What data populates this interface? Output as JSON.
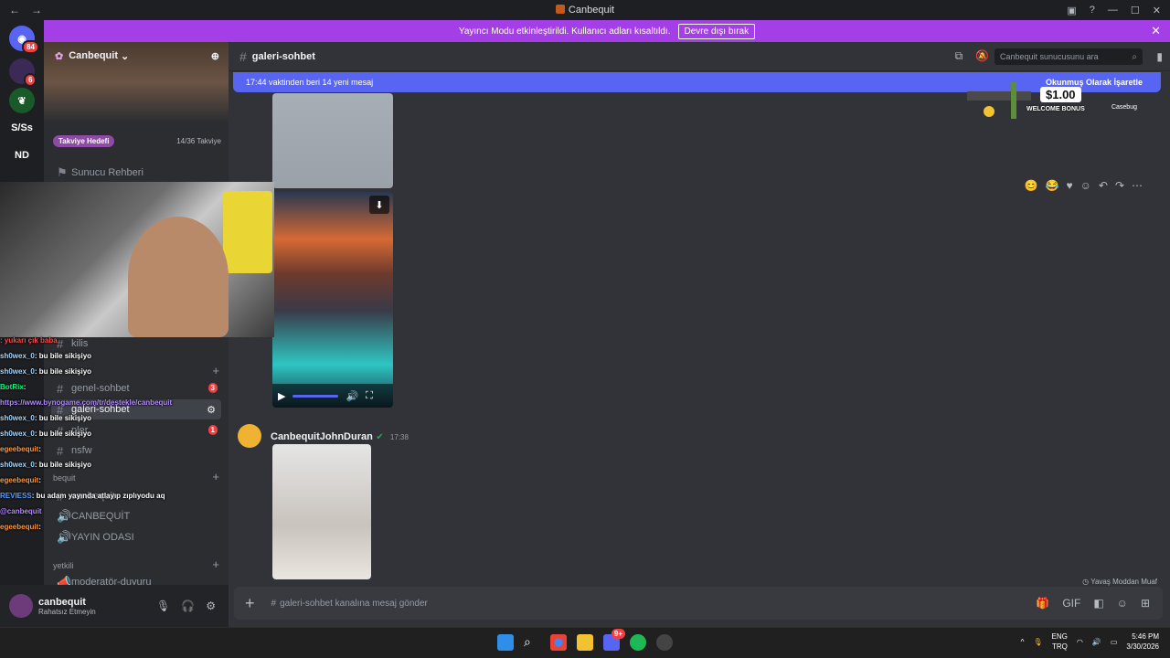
{
  "window": {
    "title": "Canbequit",
    "nav_back": "←",
    "nav_fwd": "→"
  },
  "banner": {
    "text": "Yayıncı Modu etkinleştirildi. Kullanıcı adları kısaltıldı.",
    "button": "Devre dışı bırak",
    "close": "✕"
  },
  "rail": {
    "dm_badge": "84",
    "second_badge": "6",
    "items": [
      "S/Ss",
      "ND"
    ]
  },
  "server": {
    "name": "Canbequit",
    "boost_label": "Takviye Hedefi",
    "boost_count": "14/36 Takviye",
    "guide": "Sunucu Rehberi",
    "channels": [
      {
        "name": "kilis"
      },
      {
        "name": "genel-sohbet",
        "badge": "3"
      },
      {
        "name": "galeri-sohbet"
      },
      {
        "name": "pler",
        "badge": "1"
      },
      {
        "name": "nsfw"
      },
      {
        "name": "canbequit"
      },
      {
        "name": "CANBEQUİT"
      },
      {
        "name": "YAYIN ODASI"
      },
      {
        "name": "moderatör-duyuru"
      }
    ],
    "categories": {
      "bequit": "bequit",
      "yetkili": "yetkili"
    }
  },
  "user": {
    "name": "canbequit",
    "status": "Rahatsız Etmeyin"
  },
  "channel": {
    "name": "galeri-sohbet",
    "search_placeholder": "Canbequit sunucusunu ara"
  },
  "new_messages": {
    "text": "17:44 vaktinden beri 14 yeni mesaj",
    "mark_read": "Okunmuş Olarak İşaretle"
  },
  "ad": {
    "amount": "$1.00",
    "text": "WELCOME BONUS",
    "brand": "Casebug"
  },
  "message": {
    "author": "CanbequitJohnDuran",
    "time": "17:38"
  },
  "slowmode": "Yavaş Moddan Muaf",
  "composer": {
    "placeholder": "galeri-sohbet kanalına mesaj gönder"
  },
  "chat": [
    {
      "user": "",
      "text": ": yukarı çık baba",
      "color": "#ff4d4d"
    },
    {
      "user": "sh0wex_0",
      "text": ": bu bile sikişiyo",
      "color": "#a8d8ff"
    },
    {
      "user": "sh0wex_0",
      "text": ": bu bile sikişiyo",
      "color": "#a8d8ff"
    },
    {
      "user": "BotRix",
      "text": ":",
      "color": "#00ff7f"
    },
    {
      "user": "",
      "text": "https://www.bynogame.com/tr/destekle/canbequit",
      "color": "#b38cff"
    },
    {
      "user": "sh0wex_0",
      "text": ": bu bile sikişiyo",
      "color": "#a8d8ff"
    },
    {
      "user": "sh0wex_0",
      "text": ": bu bile sikişiyo",
      "color": "#a8d8ff"
    },
    {
      "user": "egeebequit",
      "text": ":",
      "color": "#ff9a3c"
    },
    {
      "user": "sh0wex_0",
      "text": ": bu bile sikişiyo",
      "color": "#a8d8ff"
    },
    {
      "user": "egeebequit",
      "text": ":",
      "color": "#ff9a3c"
    },
    {
      "user": "REVIESS",
      "text": ": bu adam yayında atlayıp zıplıyodu aq",
      "color": "#5aa0ff"
    },
    {
      "user": "",
      "text": "@canbequit",
      "color": "#b38cff"
    },
    {
      "user": "egeebequit",
      "text": ":",
      "color": "#ff9a3c"
    }
  ],
  "taskbar": {
    "lang1": "ENG",
    "lang2": "TRQ",
    "time": "5:46 PM",
    "date": "3/30/2026",
    "badge": "9+"
  },
  "colors": {
    "accent": "#5865f2",
    "banner": "#a43ee6",
    "danger": "#f23f42"
  }
}
